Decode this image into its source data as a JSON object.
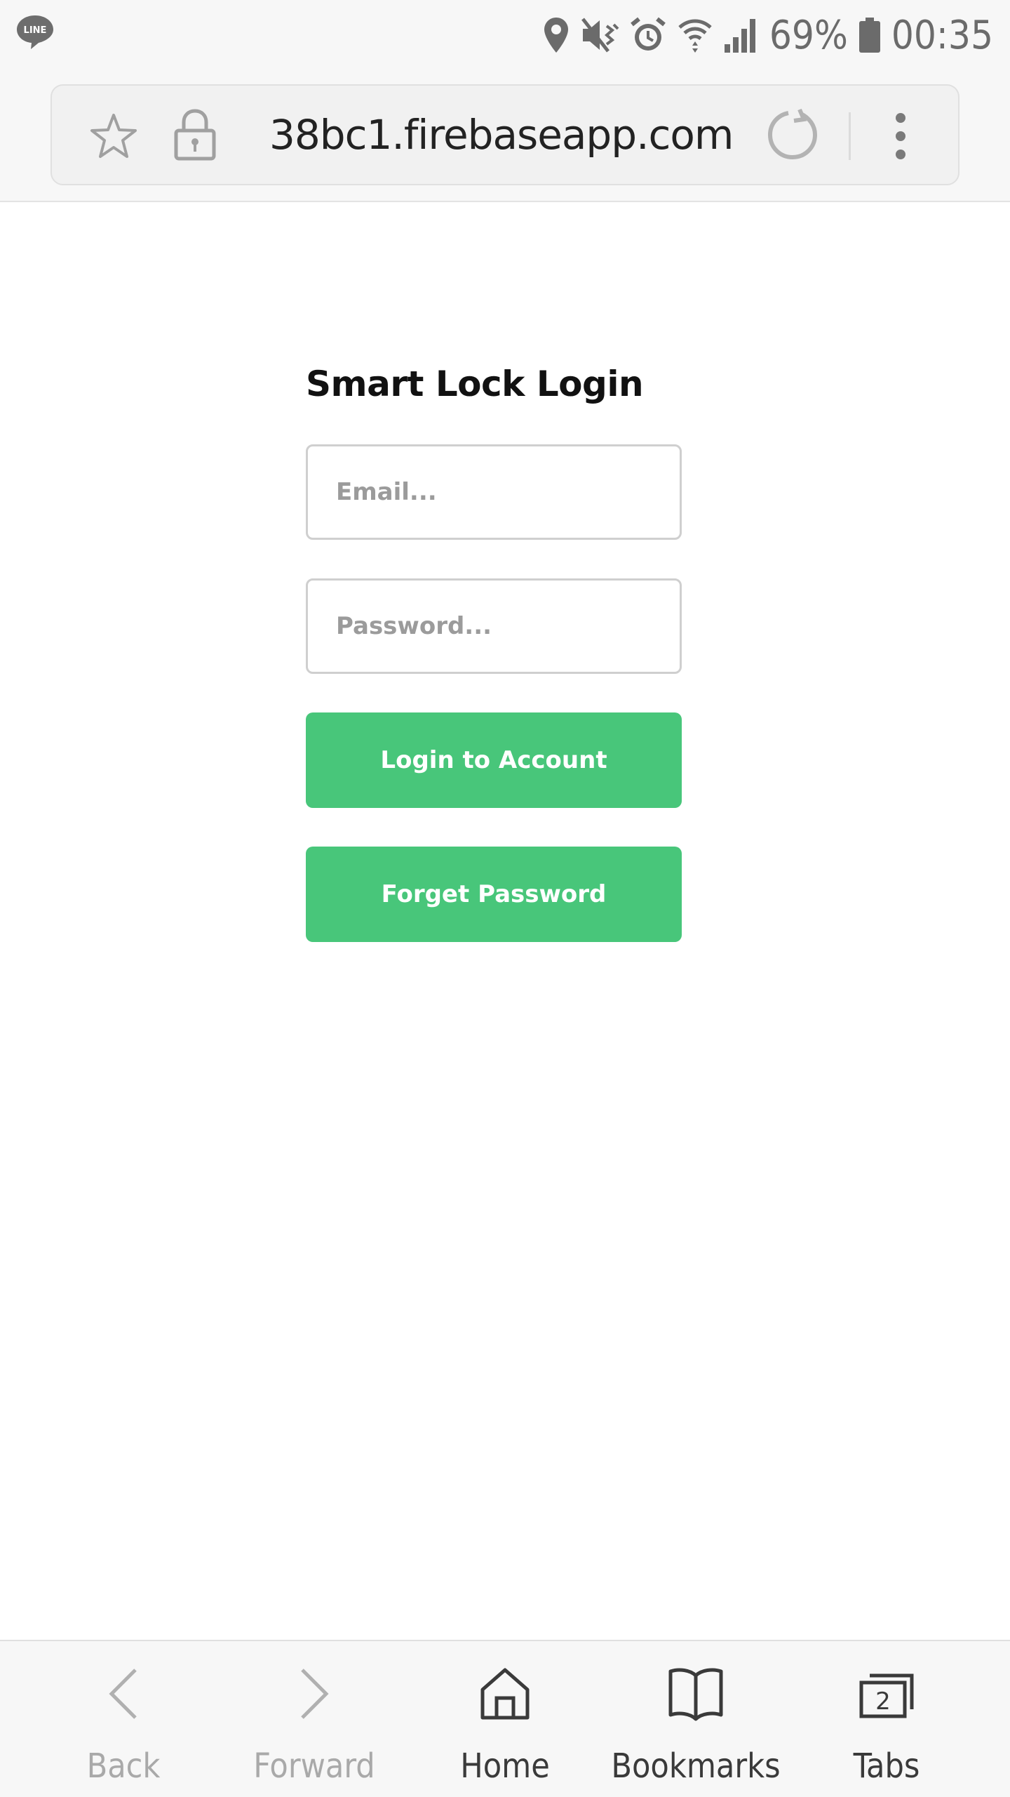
{
  "status_bar": {
    "app_icon": "line-icon",
    "app_icon_text": "LINE",
    "icons": [
      "location-icon",
      "mute-vibrate-icon",
      "alarm-icon",
      "wifi-icon",
      "signal-icon",
      "battery-icon"
    ],
    "battery": "69%",
    "time": "00:35"
  },
  "browser": {
    "url": "38bc1.firebaseapp.com",
    "icons": [
      "star-icon",
      "lock-icon",
      "reload-icon",
      "more-vert-icon"
    ]
  },
  "login": {
    "title": "Smart Lock Login",
    "email_placeholder": "Email...",
    "password_placeholder": "Password...",
    "login_button": "Login to Account",
    "forgot_button": "Forget Password",
    "accent_color": "#48c67a"
  },
  "bottom_nav": {
    "back": "Back",
    "forward": "Forward",
    "home": "Home",
    "bookmarks": "Bookmarks",
    "tabs": "Tabs",
    "tabs_count": "2"
  }
}
